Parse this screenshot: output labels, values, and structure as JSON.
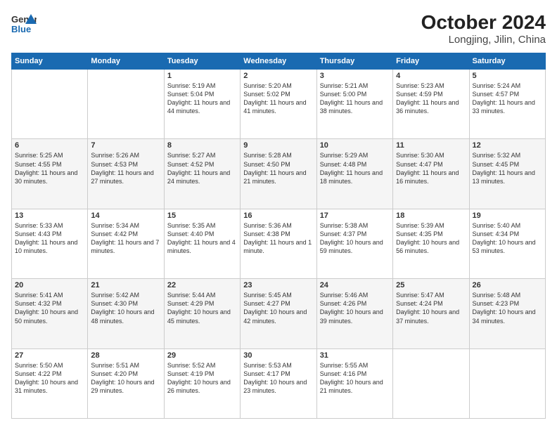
{
  "header": {
    "logo_line1": "General",
    "logo_line2": "Blue",
    "title": "October 2024",
    "subtitle": "Longjing, Jilin, China"
  },
  "days_of_week": [
    "Sunday",
    "Monday",
    "Tuesday",
    "Wednesday",
    "Thursday",
    "Friday",
    "Saturday"
  ],
  "weeks": [
    [
      {
        "num": "",
        "info": ""
      },
      {
        "num": "",
        "info": ""
      },
      {
        "num": "1",
        "info": "Sunrise: 5:19 AM\nSunset: 5:04 PM\nDaylight: 11 hours and 44 minutes."
      },
      {
        "num": "2",
        "info": "Sunrise: 5:20 AM\nSunset: 5:02 PM\nDaylight: 11 hours and 41 minutes."
      },
      {
        "num": "3",
        "info": "Sunrise: 5:21 AM\nSunset: 5:00 PM\nDaylight: 11 hours and 38 minutes."
      },
      {
        "num": "4",
        "info": "Sunrise: 5:23 AM\nSunset: 4:59 PM\nDaylight: 11 hours and 36 minutes."
      },
      {
        "num": "5",
        "info": "Sunrise: 5:24 AM\nSunset: 4:57 PM\nDaylight: 11 hours and 33 minutes."
      }
    ],
    [
      {
        "num": "6",
        "info": "Sunrise: 5:25 AM\nSunset: 4:55 PM\nDaylight: 11 hours and 30 minutes."
      },
      {
        "num": "7",
        "info": "Sunrise: 5:26 AM\nSunset: 4:53 PM\nDaylight: 11 hours and 27 minutes."
      },
      {
        "num": "8",
        "info": "Sunrise: 5:27 AM\nSunset: 4:52 PM\nDaylight: 11 hours and 24 minutes."
      },
      {
        "num": "9",
        "info": "Sunrise: 5:28 AM\nSunset: 4:50 PM\nDaylight: 11 hours and 21 minutes."
      },
      {
        "num": "10",
        "info": "Sunrise: 5:29 AM\nSunset: 4:48 PM\nDaylight: 11 hours and 18 minutes."
      },
      {
        "num": "11",
        "info": "Sunrise: 5:30 AM\nSunset: 4:47 PM\nDaylight: 11 hours and 16 minutes."
      },
      {
        "num": "12",
        "info": "Sunrise: 5:32 AM\nSunset: 4:45 PM\nDaylight: 11 hours and 13 minutes."
      }
    ],
    [
      {
        "num": "13",
        "info": "Sunrise: 5:33 AM\nSunset: 4:43 PM\nDaylight: 11 hours and 10 minutes."
      },
      {
        "num": "14",
        "info": "Sunrise: 5:34 AM\nSunset: 4:42 PM\nDaylight: 11 hours and 7 minutes."
      },
      {
        "num": "15",
        "info": "Sunrise: 5:35 AM\nSunset: 4:40 PM\nDaylight: 11 hours and 4 minutes."
      },
      {
        "num": "16",
        "info": "Sunrise: 5:36 AM\nSunset: 4:38 PM\nDaylight: 11 hours and 1 minute."
      },
      {
        "num": "17",
        "info": "Sunrise: 5:38 AM\nSunset: 4:37 PM\nDaylight: 10 hours and 59 minutes."
      },
      {
        "num": "18",
        "info": "Sunrise: 5:39 AM\nSunset: 4:35 PM\nDaylight: 10 hours and 56 minutes."
      },
      {
        "num": "19",
        "info": "Sunrise: 5:40 AM\nSunset: 4:34 PM\nDaylight: 10 hours and 53 minutes."
      }
    ],
    [
      {
        "num": "20",
        "info": "Sunrise: 5:41 AM\nSunset: 4:32 PM\nDaylight: 10 hours and 50 minutes."
      },
      {
        "num": "21",
        "info": "Sunrise: 5:42 AM\nSunset: 4:30 PM\nDaylight: 10 hours and 48 minutes."
      },
      {
        "num": "22",
        "info": "Sunrise: 5:44 AM\nSunset: 4:29 PM\nDaylight: 10 hours and 45 minutes."
      },
      {
        "num": "23",
        "info": "Sunrise: 5:45 AM\nSunset: 4:27 PM\nDaylight: 10 hours and 42 minutes."
      },
      {
        "num": "24",
        "info": "Sunrise: 5:46 AM\nSunset: 4:26 PM\nDaylight: 10 hours and 39 minutes."
      },
      {
        "num": "25",
        "info": "Sunrise: 5:47 AM\nSunset: 4:24 PM\nDaylight: 10 hours and 37 minutes."
      },
      {
        "num": "26",
        "info": "Sunrise: 5:48 AM\nSunset: 4:23 PM\nDaylight: 10 hours and 34 minutes."
      }
    ],
    [
      {
        "num": "27",
        "info": "Sunrise: 5:50 AM\nSunset: 4:22 PM\nDaylight: 10 hours and 31 minutes."
      },
      {
        "num": "28",
        "info": "Sunrise: 5:51 AM\nSunset: 4:20 PM\nDaylight: 10 hours and 29 minutes."
      },
      {
        "num": "29",
        "info": "Sunrise: 5:52 AM\nSunset: 4:19 PM\nDaylight: 10 hours and 26 minutes."
      },
      {
        "num": "30",
        "info": "Sunrise: 5:53 AM\nSunset: 4:17 PM\nDaylight: 10 hours and 23 minutes."
      },
      {
        "num": "31",
        "info": "Sunrise: 5:55 AM\nSunset: 4:16 PM\nDaylight: 10 hours and 21 minutes."
      },
      {
        "num": "",
        "info": ""
      },
      {
        "num": "",
        "info": ""
      }
    ]
  ]
}
